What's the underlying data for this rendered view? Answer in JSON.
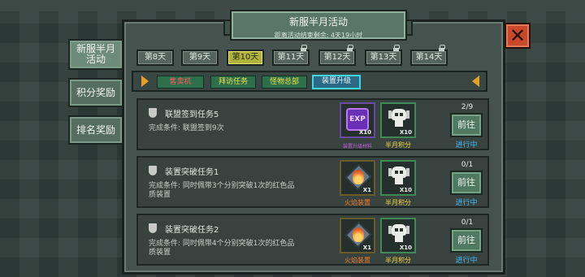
{
  "title": "新服半月活动",
  "subtitle": "距离活动结束剩余: 4天19小时",
  "side_tabs": [
    "新服半月活动",
    "积分奖励",
    "排名奖励"
  ],
  "day_tabs": [
    {
      "label": "第8天",
      "locked": false
    },
    {
      "label": "第9天",
      "locked": false
    },
    {
      "label": "第10天",
      "locked": false,
      "active": true
    },
    {
      "label": "第11天",
      "locked": true
    },
    {
      "label": "第12天",
      "locked": true
    },
    {
      "label": "第13天",
      "locked": true
    },
    {
      "label": "第14天",
      "locked": true
    }
  ],
  "categories": [
    {
      "label": "售卖机",
      "color": "red"
    },
    {
      "label": "拜访任务",
      "color": "yellow"
    },
    {
      "label": "怪物总部",
      "color": "yellow"
    },
    {
      "label": "装置升级",
      "active": true
    }
  ],
  "tasks": [
    {
      "title": "联盟签到任务5",
      "condition": "完成条件: 联盟签到9次",
      "rewards": [
        {
          "icon": "exp-icon",
          "qty": "X10",
          "label": "装置升级材料"
        },
        {
          "icon": "skull-icon",
          "qty": "X10",
          "label": "半月积分"
        }
      ],
      "progress": "2/9",
      "button": "前往",
      "status": "进行中"
    },
    {
      "title": "装置突破任务1",
      "condition": "完成条件: 同时佩带3个分别突破1次的红色品质装置",
      "rewards": [
        {
          "icon": "flame-icon",
          "qty": "X1",
          "label": "火焰装置"
        },
        {
          "icon": "skull-icon",
          "qty": "X10",
          "label": "半月积分"
        }
      ],
      "progress": "0/1",
      "button": "前往",
      "status": "进行中"
    },
    {
      "title": "装置突破任务2",
      "condition": "完成条件: 同时佩带4个分别突破1次的红色品质装置",
      "rewards": [
        {
          "icon": "flame-icon",
          "qty": "X1",
          "label": "火焰装置"
        },
        {
          "icon": "skull-icon",
          "qty": "X10",
          "label": "半月积分"
        }
      ],
      "progress": "0/1",
      "button": "前往",
      "status": "进行中"
    }
  ],
  "colors": {
    "accent": "#b2b33a",
    "status": "#46b8f2",
    "close": "#c94a2b"
  }
}
